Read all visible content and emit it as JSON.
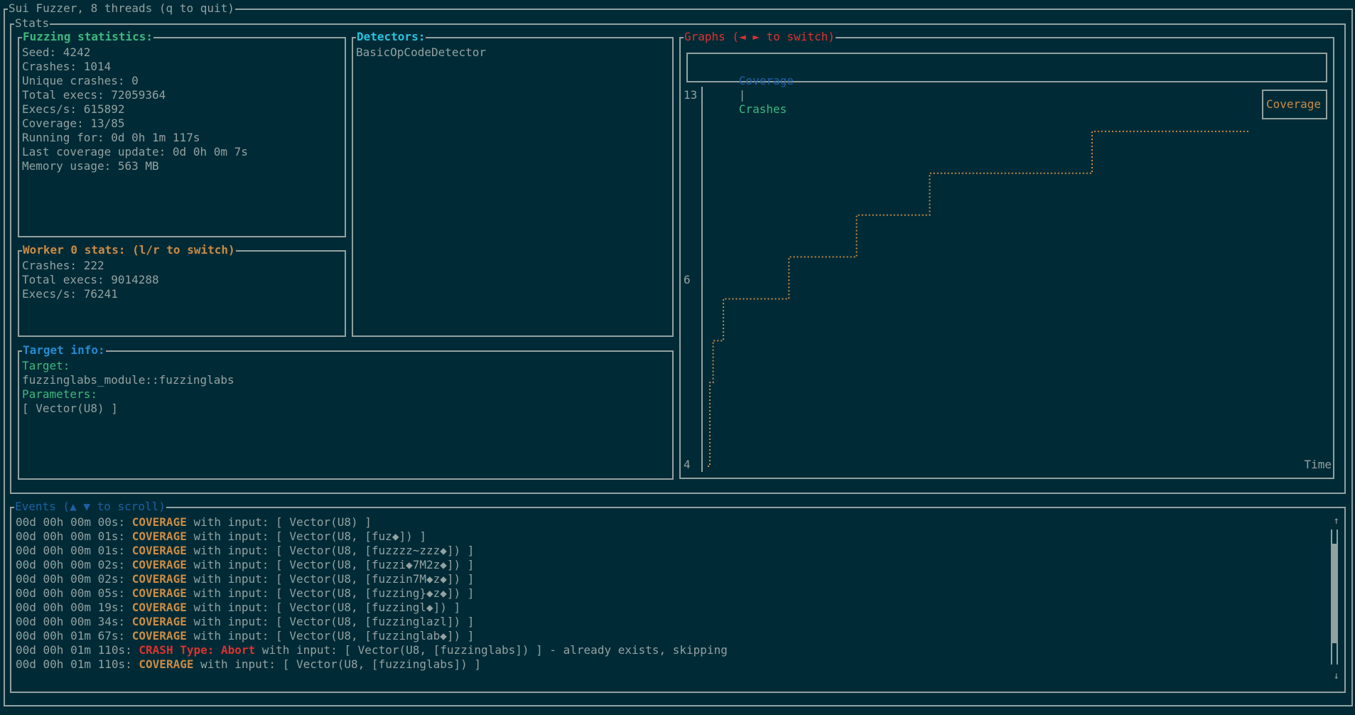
{
  "window": {
    "title": "Sui Fuzzer, 8 threads (q to quit)"
  },
  "stats_panel": {
    "title": "Stats"
  },
  "fuzzing_stats": {
    "title": "Fuzzing statistics:",
    "lines": [
      "Seed: 4242",
      "Crashes: 1014",
      "Unique crashes: 0",
      "Total execs: 72059364",
      "Execs/s: 615892",
      "Coverage: 13/85",
      "Running for: 0d 0h 1m 117s",
      "Last coverage update: 0d 0h 0m 7s",
      "Memory usage: 563 MB"
    ]
  },
  "worker_stats": {
    "title": "Worker 0 stats: (l/r to switch)",
    "lines": [
      "Crashes: 222",
      "Total execs: 9014288",
      "Execs/s: 76241"
    ]
  },
  "detectors": {
    "title": "Detectors:",
    "items": [
      "BasicOpCodeDetector"
    ]
  },
  "target_info": {
    "title": "Target info:",
    "target_label": "Target:",
    "target_value": "fuzzinglabs_module::fuzzinglabs",
    "params_label": "Parameters:",
    "params_value": "[ Vector(U8) ]"
  },
  "graphs": {
    "title": "Graphs (◄ ► to switch)",
    "tabs": [
      "Coverage",
      "Crashes"
    ],
    "tab_separator": "|",
    "selected_tab": "Coverage",
    "legend": "Coverage",
    "x_label": "Time",
    "colors": {
      "line": "#cb8b46",
      "selected_tab": "#1f5fa3",
      "other_tab": "#3fb77f"
    }
  },
  "chart_data": {
    "type": "line",
    "title": "",
    "xlabel": "Time",
    "ylabel": "",
    "ylim": [
      4,
      13
    ],
    "y_ticks": [
      "13",
      "6",
      "4"
    ],
    "series": [
      {
        "name": "Coverage",
        "step": true,
        "x": [
          0,
          0.4,
          1.0,
          2.9,
          15.0,
          27.5,
          41.0,
          71.0,
          100
        ],
        "values": [
          4,
          6,
          7,
          8,
          9,
          10,
          11,
          12,
          12
        ]
      }
    ]
  },
  "events": {
    "title": "Events (▲ ▼ to scroll)",
    "rows": [
      {
        "time": "00d 00h 00m 00s:",
        "kind": "COVERAGE",
        "kind_type": "coverage",
        "rest": " with input: [ Vector(U8) ]"
      },
      {
        "time": "00d 00h 00m 01s:",
        "kind": "COVERAGE",
        "kind_type": "coverage",
        "rest": " with input: [ Vector(U8, [fuz◆]) ]"
      },
      {
        "time": "00d 00h 00m 01s:",
        "kind": "COVERAGE",
        "kind_type": "coverage",
        "rest": " with input: [ Vector(U8, [fuzzzz~zzz◆]) ]"
      },
      {
        "time": "00d 00h 00m 02s:",
        "kind": "COVERAGE",
        "kind_type": "coverage",
        "rest": " with input: [ Vector(U8, [fuzzi◆7M2z◆]) ]"
      },
      {
        "time": "00d 00h 00m 02s:",
        "kind": "COVERAGE",
        "kind_type": "coverage",
        "rest": " with input: [ Vector(U8, [fuzzin7M◆z◆]) ]"
      },
      {
        "time": "00d 00h 00m 05s:",
        "kind": "COVERAGE",
        "kind_type": "coverage",
        "rest": " with input: [ Vector(U8, [fuzzing}◆z◆]) ]"
      },
      {
        "time": "00d 00h 00m 19s:",
        "kind": "COVERAGE",
        "kind_type": "coverage",
        "rest": " with input: [ Vector(U8, [fuzzingl◆]) ]"
      },
      {
        "time": "00d 00h 00m 34s:",
        "kind": "COVERAGE",
        "kind_type": "coverage",
        "rest": " with input: [ Vector(U8, [fuzzinglazl]) ]"
      },
      {
        "time": "00d 00h 01m 67s:",
        "kind": "COVERAGE",
        "kind_type": "coverage",
        "rest": " with input: [ Vector(U8, [fuzzinglab◆]) ]"
      },
      {
        "time": "00d 00h 01m 110s:",
        "kind": "CRASH Type: Abort",
        "kind_type": "crash",
        "rest": " with input: [ Vector(U8, [fuzzinglabs]) ] - already exists, skipping"
      },
      {
        "time": "00d 00h 01m 110s:",
        "kind": "COVERAGE",
        "kind_type": "coverage",
        "rest": " with input: [ Vector(U8, [fuzzinglabs]) ]"
      }
    ],
    "scroll_up_icon": "↑",
    "scroll_down_icon": "↓"
  }
}
